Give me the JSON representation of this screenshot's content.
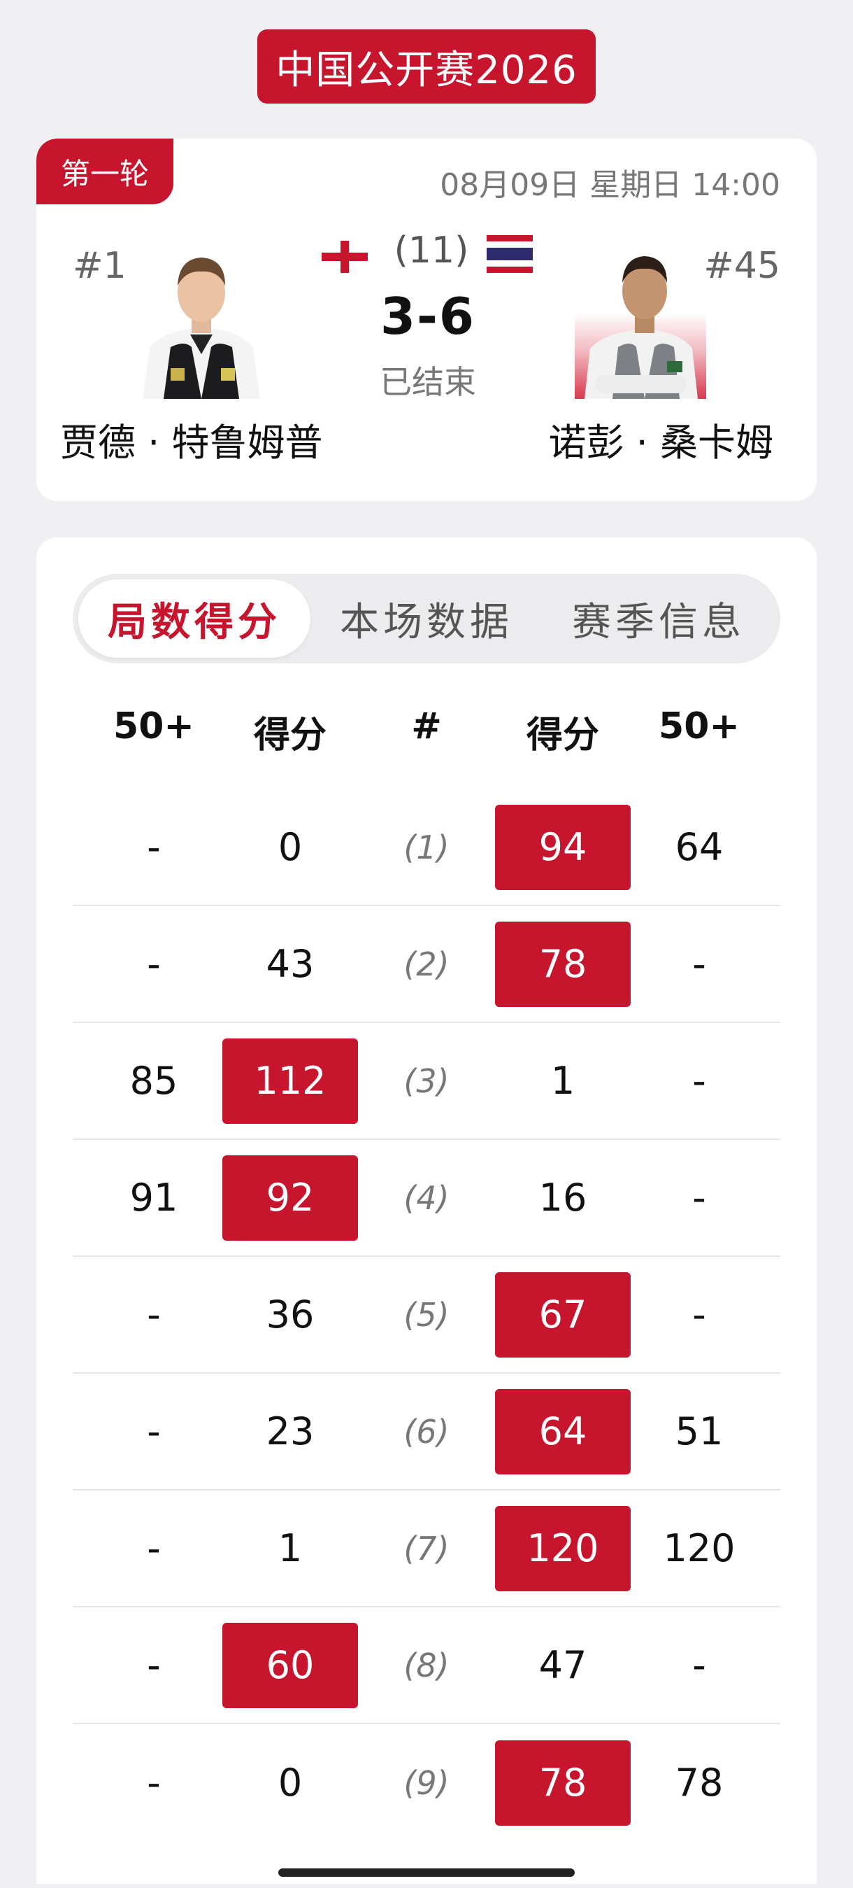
{
  "tournament_title": "中国公开赛2026",
  "match": {
    "round": "第一轮",
    "datetime": "08月09日 星期日 14:00",
    "best_of": "(11)",
    "score": "3-6",
    "status": "已结束",
    "player_left": {
      "rank": "#1",
      "name": "贾德 · 特鲁姆普",
      "flag": "england-flag-icon"
    },
    "player_right": {
      "rank": "#45",
      "name": "诺彭 · 桑卡姆",
      "flag": "thailand-flag-icon"
    }
  },
  "tabs": [
    {
      "label": "局数得分",
      "active": true
    },
    {
      "label": "本场数据",
      "active": false
    },
    {
      "label": "赛季信息",
      "active": false
    }
  ],
  "table": {
    "headers": [
      "50+",
      "得分",
      "#",
      "得分",
      "50+"
    ],
    "frames": [
      {
        "left_break": "-",
        "left_score": "0",
        "frame": "(1)",
        "right_score": "94",
        "right_break": "64",
        "winner": "right"
      },
      {
        "left_break": "-",
        "left_score": "43",
        "frame": "(2)",
        "right_score": "78",
        "right_break": "-",
        "winner": "right"
      },
      {
        "left_break": "85",
        "left_score": "112",
        "frame": "(3)",
        "right_score": "1",
        "right_break": "-",
        "winner": "left"
      },
      {
        "left_break": "91",
        "left_score": "92",
        "frame": "(4)",
        "right_score": "16",
        "right_break": "-",
        "winner": "left"
      },
      {
        "left_break": "-",
        "left_score": "36",
        "frame": "(5)",
        "right_score": "67",
        "right_break": "-",
        "winner": "right"
      },
      {
        "left_break": "-",
        "left_score": "23",
        "frame": "(6)",
        "right_score": "64",
        "right_break": "51",
        "winner": "right"
      },
      {
        "left_break": "-",
        "left_score": "1",
        "frame": "(7)",
        "right_score": "120",
        "right_break": "120",
        "winner": "right"
      },
      {
        "left_break": "-",
        "left_score": "60",
        "frame": "(8)",
        "right_score": "47",
        "right_break": "-",
        "winner": "left"
      },
      {
        "left_break": "-",
        "left_score": "0",
        "frame": "(9)",
        "right_score": "78",
        "right_break": "78",
        "winner": "right"
      }
    ]
  },
  "colors": {
    "accent": "#c8152e",
    "background": "#f0f0f3"
  }
}
